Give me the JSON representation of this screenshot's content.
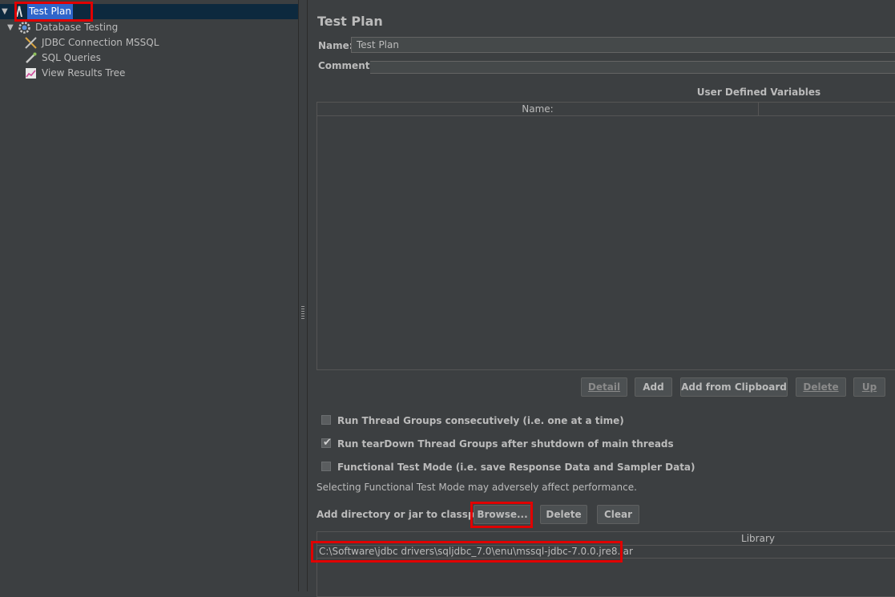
{
  "tree": {
    "items": [
      {
        "label": "Test Plan",
        "icon": "test-plan-icon",
        "selected": true
      },
      {
        "label": "Database Testing",
        "icon": "thread-group-gear-icon"
      },
      {
        "label": "JDBC Connection MSSQL",
        "icon": "config-tools-icon"
      },
      {
        "label": "SQL Queries",
        "icon": "sampler-pipette-icon"
      },
      {
        "label": "View Results Tree",
        "icon": "listener-graph-icon"
      }
    ]
  },
  "main": {
    "title": "Test Plan",
    "name_label": "Name:",
    "name_value": "Test Plan",
    "comments_label": "Comments:",
    "udv": {
      "title": "User Defined Variables",
      "col_name": "Name:"
    },
    "table_buttons": {
      "detail": "Detail",
      "add": "Add",
      "add_clipboard": "Add from Clipboard",
      "delete": "Delete",
      "up": "Up"
    },
    "checkboxes": [
      {
        "label": "Run Thread Groups consecutively (i.e. one at a time)",
        "checked": false
      },
      {
        "label": "Run tearDown Thread Groups after shutdown of main threads",
        "checked": true
      },
      {
        "label": "Functional Test Mode (i.e. save Response Data and Sampler Data)",
        "checked": false
      }
    ],
    "perf_note": "Selecting Functional Test Mode may adversely affect performance.",
    "classpath": {
      "label": "Add directory or jar to classpath",
      "browse": "Browse...",
      "delete": "Delete",
      "clear": "Clear"
    },
    "library": {
      "col": "Library",
      "rows": [
        "C:\\Software\\jdbc drivers\\sqljdbc_7.0\\enu\\mssql-jdbc-7.0.0.jre8.jar"
      ]
    }
  },
  "colors": {
    "background": "#3c3f41",
    "selection": "#2f65ca",
    "highlight_box": "#e00000"
  }
}
